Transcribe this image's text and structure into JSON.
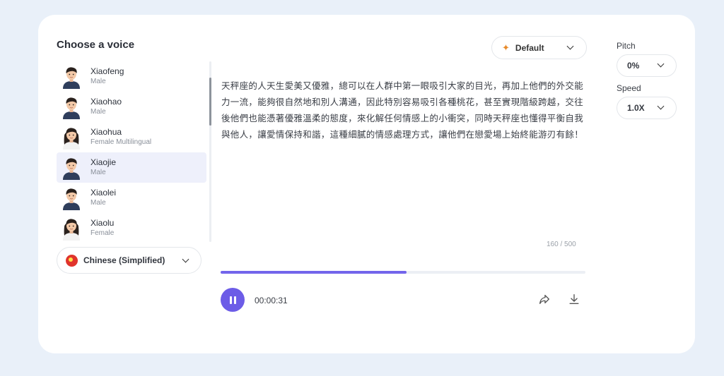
{
  "title": "Choose a voice",
  "voices": [
    {
      "name": "Xiaofeng",
      "sub": "Male",
      "gender": "male",
      "selected": false
    },
    {
      "name": "Xiaohao",
      "sub": "Male",
      "gender": "male",
      "selected": false
    },
    {
      "name": "Xiaohua",
      "sub": "Female Multilingual",
      "gender": "female",
      "selected": false
    },
    {
      "name": "Xiaojie",
      "sub": "Male",
      "gender": "male",
      "selected": true
    },
    {
      "name": "Xiaolei",
      "sub": "Male",
      "gender": "male",
      "selected": false
    },
    {
      "name": "Xiaolu",
      "sub": "Female",
      "gender": "female",
      "selected": false
    }
  ],
  "language": {
    "label": "Chinese (Simplified)",
    "flag_icon": "china-flag-icon"
  },
  "style": {
    "label": "Default",
    "icon": "default-style-icon"
  },
  "text": "天秤座的人天生愛美又優雅，總可以在人群中第一眼吸引大家的目光，再加上他們的外交能力一流，能夠很自然地和別人溝通，因此特別容易吸引各種桃花，甚至實現階級跨越，交往後他們也能憑著優雅溫柔的態度，來化解任何情感上的小衝突，同時天秤座也懂得平衡自我與他人，讓愛情保持和諧，這種細膩的情感處理方式，讓他們在戀愛場上始終能游刃有餘！",
  "char_count": "160 / 500",
  "player": {
    "progress": 0.51,
    "time": "00:00:31",
    "state": "playing"
  },
  "pitch": {
    "label": "Pitch",
    "value": "0%"
  },
  "speed": {
    "label": "Speed",
    "value": "1.0X"
  },
  "colors": {
    "accent": "#6c5ce7",
    "background": "#e9f0f9",
    "selected_row": "#eef0fb"
  }
}
